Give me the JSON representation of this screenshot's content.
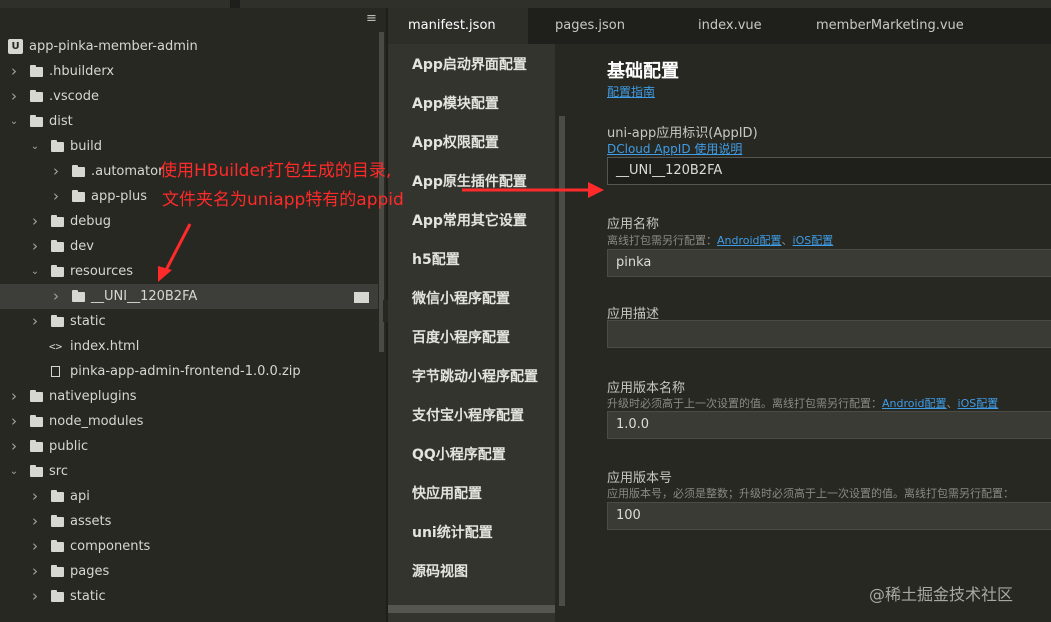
{
  "explorer": {
    "project": "app-pinka-member-admin",
    "items": [
      {
        "label": ".hbuilderx",
        "kind": "folder",
        "expanded": false
      },
      {
        "label": ".vscode",
        "kind": "folder",
        "expanded": false
      },
      {
        "label": "dist",
        "kind": "folder",
        "expanded": true
      },
      {
        "label": "build",
        "kind": "folder",
        "expanded": true
      },
      {
        "label": ".automator",
        "kind": "folder",
        "expanded": false
      },
      {
        "label": "app-plus",
        "kind": "folder",
        "expanded": false
      },
      {
        "label": "debug",
        "kind": "folder",
        "expanded": false
      },
      {
        "label": "dev",
        "kind": "folder",
        "expanded": false
      },
      {
        "label": "resources",
        "kind": "folder",
        "expanded": true
      },
      {
        "label": "__UNI__120B2FA",
        "kind": "folder",
        "expanded": false,
        "selected": true
      },
      {
        "label": "static",
        "kind": "folder",
        "expanded": false
      },
      {
        "label": "index.html",
        "kind": "html"
      },
      {
        "label": "pinka-app-admin-frontend-1.0.0.zip",
        "kind": "file"
      },
      {
        "label": "nativeplugins",
        "kind": "folder",
        "expanded": false
      },
      {
        "label": "node_modules",
        "kind": "folder",
        "expanded": false
      },
      {
        "label": "public",
        "kind": "folder",
        "expanded": false
      },
      {
        "label": "src",
        "kind": "folder",
        "expanded": true
      },
      {
        "label": "api",
        "kind": "folder",
        "expanded": false
      },
      {
        "label": "assets",
        "kind": "folder",
        "expanded": false
      },
      {
        "label": "components",
        "kind": "folder",
        "expanded": false
      },
      {
        "label": "pages",
        "kind": "folder",
        "expanded": false
      },
      {
        "label": "static",
        "kind": "folder",
        "expanded": false
      }
    ]
  },
  "tabs": [
    "manifest.json",
    "pages.json",
    "index.vue",
    "memberMarketing.vue"
  ],
  "nav": [
    "App启动界面配置",
    "App模块配置",
    "App权限配置",
    "App原生插件配置",
    "App常用其它设置",
    "h5配置",
    "微信小程序配置",
    "百度小程序配置",
    "字节跳动小程序配置",
    "支付宝小程序配置",
    "QQ小程序配置",
    "快应用配置",
    "uni统计配置",
    "源码视图"
  ],
  "content": {
    "title": "基础配置",
    "guide_link": "配置指南",
    "appid_label": "uni-app应用标识(AppID)",
    "appid_link": "DCloud AppID 使用说明",
    "appid_value": "__UNI__120B2FA",
    "name_label": "应用名称",
    "name_hint": "离线打包需另行配置：",
    "name_hint_android": "Android配置",
    "name_hint_sep": "、",
    "name_hint_ios": "iOS配置",
    "name_value": "pinka",
    "desc_label": "应用描述",
    "desc_value": "",
    "version_label": "应用版本名称",
    "version_hint": "升级时必须高于上一次设置的值。离线打包需另行配置：",
    "version_hint_android": "Android配置",
    "version_hint_sep": "、",
    "version_hint_ios": "iOS配置",
    "version_value": "1.0.0",
    "code_label": "应用版本号",
    "code_hint": "应用版本号，必须是整数；升级时必须高于上一次设置的值。离线打包需另行配置：",
    "code_value": "100"
  },
  "annotation": {
    "line1": "使用HBuilder打包生成的目录,",
    "line2": "文件夹名为uniapp特有的appid",
    "color": "#ff2a2a"
  },
  "watermark": "@稀土掘金技术社区",
  "colors": {
    "background": "#272822",
    "link": "#3f9ce6",
    "selected_row": "#3d3e39"
  }
}
